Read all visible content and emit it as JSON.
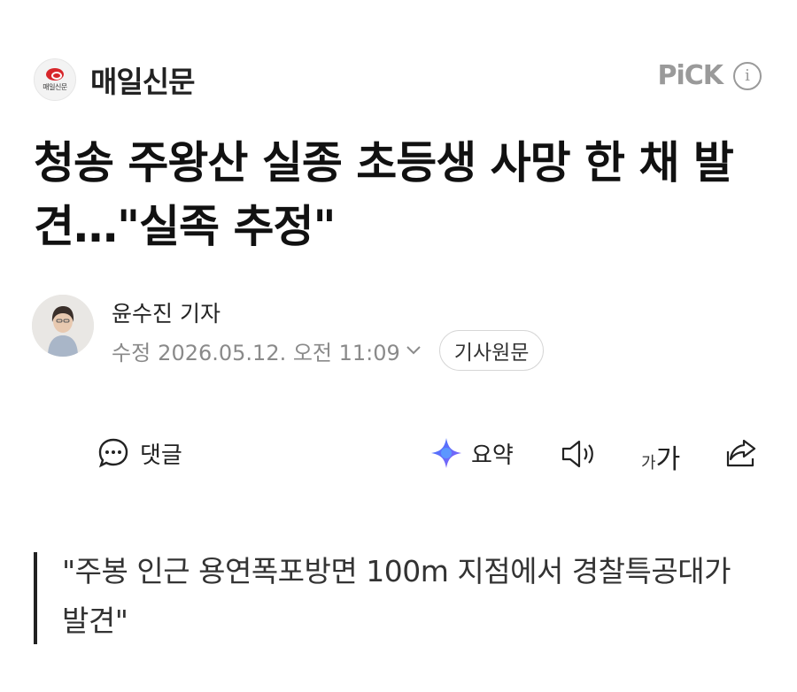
{
  "press": {
    "logo_text": "매일신문",
    "name": "매일신문",
    "pick_label": "PiCK",
    "info_icon": "info-icon"
  },
  "headline": "청송 주왕산 실종 초등생 사망 한 채 발견…\"실족 추정\"",
  "byline": {
    "author": "윤수진 기자",
    "date_label": "수정",
    "date_value": "2026.05.12. 오전 11:09",
    "original_button": "기사원문"
  },
  "toolbar": {
    "comment_label": "댓글",
    "summary_label": "요약",
    "font_small": "가",
    "font_big": "가"
  },
  "quote": "\"주봉 인근 용연폭포방면 100m 지점에서 경찰특공대가 발견\"",
  "colors": {
    "brand_red": "#d7262b",
    "pick_gray": "#9a9a9a",
    "summary_blue": "#3d7bff",
    "summary_purple": "#8b5cf6"
  },
  "icons": [
    "comment-icon",
    "sparkle-icon",
    "speaker-icon",
    "share-icon",
    "chevron-down-icon"
  ]
}
